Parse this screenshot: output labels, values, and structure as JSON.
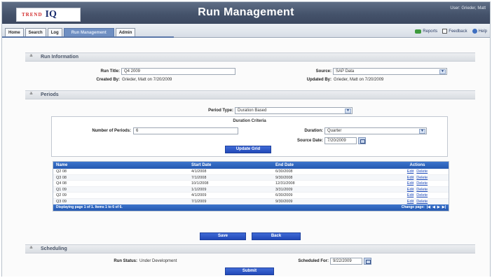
{
  "header": {
    "logo_trend": "TREND",
    "logo_iq": "IQ",
    "title": "Run Management",
    "user": "User: Grieder, Matt"
  },
  "nav": {
    "tabs": [
      {
        "label": "Home"
      },
      {
        "label": "Search"
      },
      {
        "label": "Log"
      },
      {
        "label": "Run Management"
      },
      {
        "label": "Admin"
      }
    ],
    "links": {
      "reports": "Reports",
      "feedback": "Feedback",
      "help": "Help"
    }
  },
  "run_info": {
    "section_title": "Run Information",
    "run_title_label": "Run Title:",
    "run_title_value": "Q4 2009",
    "source_label": "Source:",
    "source_value": "SAP Data",
    "created_by_label": "Created By:",
    "created_by_value": "Grieder, Matt on 7/20/2009",
    "updated_by_label": "Updated By:",
    "updated_by_value": "Grieder, Matt on 7/20/2009"
  },
  "periods": {
    "section_title": "Periods",
    "period_type_label": "Period Type:",
    "period_type_value": "Duration Based",
    "criteria_title": "Duration Criteria",
    "num_periods_label": "Number of Periods:",
    "num_periods_value": "6",
    "duration_label": "Duration:",
    "duration_value": "Quarter",
    "source_date_label": "Source Date:",
    "source_date_value": "7/20/2009",
    "update_grid_label": "Update Grid",
    "table": {
      "headers": {
        "name": "Name",
        "start": "Start Date",
        "end": "End Date",
        "actions": "Actions"
      },
      "rows": [
        {
          "name": "Q2 08",
          "start": "4/1/2008",
          "end": "6/30/2008"
        },
        {
          "name": "Q3 08",
          "start": "7/1/2008",
          "end": "9/30/2008"
        },
        {
          "name": "Q4 08",
          "start": "10/1/2008",
          "end": "12/31/2008"
        },
        {
          "name": "Q1 09",
          "start": "1/1/2009",
          "end": "3/31/2009"
        },
        {
          "name": "Q2 09",
          "start": "4/1/2009",
          "end": "6/30/2009"
        },
        {
          "name": "Q3 09",
          "start": "7/1/2009",
          "end": "9/30/2009"
        }
      ],
      "edit_label": "Edit",
      "delete_label": "Delete",
      "footer_text": "Displaying page 1 of 1. Items 1 to 6 of 6.",
      "change_page_label": "Change page:",
      "pager_first": "|◀",
      "pager_prev": "◀",
      "pager_next": "▶",
      "pager_last": "▶|"
    },
    "save_label": "Save",
    "back_label": "Back"
  },
  "scheduling": {
    "section_title": "Scheduling",
    "run_status_label": "Run Status:",
    "run_status_value": "Under Development",
    "scheduled_for_label": "Scheduled For:",
    "scheduled_for_value": "9/22/2009",
    "submit_label": "Submit"
  },
  "colors": {
    "header_bg": "#45536b",
    "accent_blue": "#2558b0",
    "active_tab": "#6f8fc2"
  }
}
